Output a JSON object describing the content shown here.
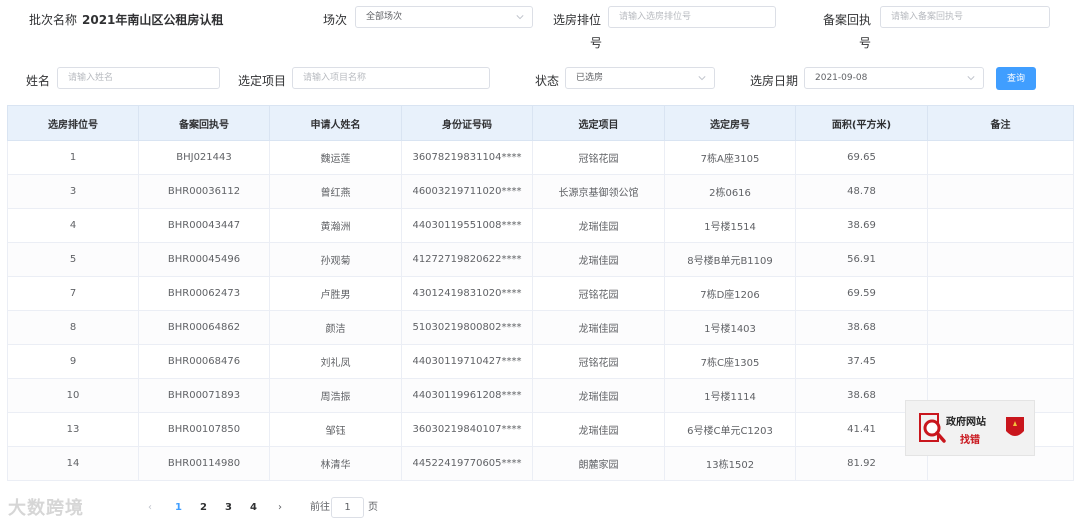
{
  "filters": {
    "batch_label": "批次名称",
    "batch_value": "2021年南山区公租房认租",
    "session_label": "场次",
    "session_value": "全部场次",
    "rank_label_1": "选房排位",
    "rank_label_2": "号",
    "rank_placeholder": "请输入选房排位号",
    "receipt_label_1": "备案回执",
    "receipt_label_2": "号",
    "receipt_placeholder": "请输入备案回执号",
    "name_label": "姓名",
    "name_placeholder": "请输入姓名",
    "project_label": "选定项目",
    "project_placeholder": "请输入项目名称",
    "status_label": "状态",
    "status_value": "已选房",
    "date_label": "选房日期",
    "date_value": "2021-09-08",
    "query_label": "查询"
  },
  "table": {
    "columns": [
      "选房排位号",
      "备案回执号",
      "申请人姓名",
      "身份证号码",
      "选定项目",
      "选定房号",
      "面积(平方米)",
      "备注"
    ],
    "rows": [
      [
        "1",
        "BHJ021443",
        "魏运莲",
        "36078219831104****",
        "冠铭花园",
        "7栋A座3105",
        "69.65",
        ""
      ],
      [
        "3",
        "BHR00036112",
        "曾红燕",
        "46003219711020****",
        "长源京基御领公馆",
        "2栋0616",
        "48.78",
        ""
      ],
      [
        "4",
        "BHR00043447",
        "黄瀚洲",
        "44030119551008****",
        "龙瑞佳园",
        "1号楼1514",
        "38.69",
        ""
      ],
      [
        "5",
        "BHR00045496",
        "孙观菊",
        "41272719820622****",
        "龙瑞佳园",
        "8号楼B单元B1109",
        "56.91",
        ""
      ],
      [
        "7",
        "BHR00062473",
        "卢胜男",
        "43012419831020****",
        "冠铭花园",
        "7栋D座1206",
        "69.59",
        ""
      ],
      [
        "8",
        "BHR00064862",
        "颜洁",
        "51030219800802****",
        "龙瑞佳园",
        "1号楼1403",
        "38.68",
        ""
      ],
      [
        "9",
        "BHR00068476",
        "刘礼凤",
        "44030119710427****",
        "冠铭花园",
        "7栋C座1305",
        "37.45",
        ""
      ],
      [
        "10",
        "BHR00071893",
        "周浩振",
        "44030119961208****",
        "龙瑞佳园",
        "1号楼1114",
        "38.68",
        ""
      ],
      [
        "13",
        "BHR00107850",
        "邹钰",
        "36030219840107****",
        "龙瑞佳园",
        "6号楼C单元C1203",
        "41.41",
        ""
      ],
      [
        "14",
        "BHR00114980",
        "林清华",
        "44522419770605****",
        "朗麓家园",
        "13栋1502",
        "81.92",
        ""
      ]
    ]
  },
  "pager": {
    "pages": [
      "1",
      "2",
      "3",
      "4"
    ],
    "goto_label": "前往",
    "goto_value": "1",
    "page_suffix": "页"
  },
  "badge": {
    "line1": "政府网站",
    "line2": "找错"
  },
  "watermark": "大数跨境",
  "colors": {
    "primary": "#409eff",
    "header_bg": "#e8f1fb",
    "badge_red": "#c9161d"
  }
}
